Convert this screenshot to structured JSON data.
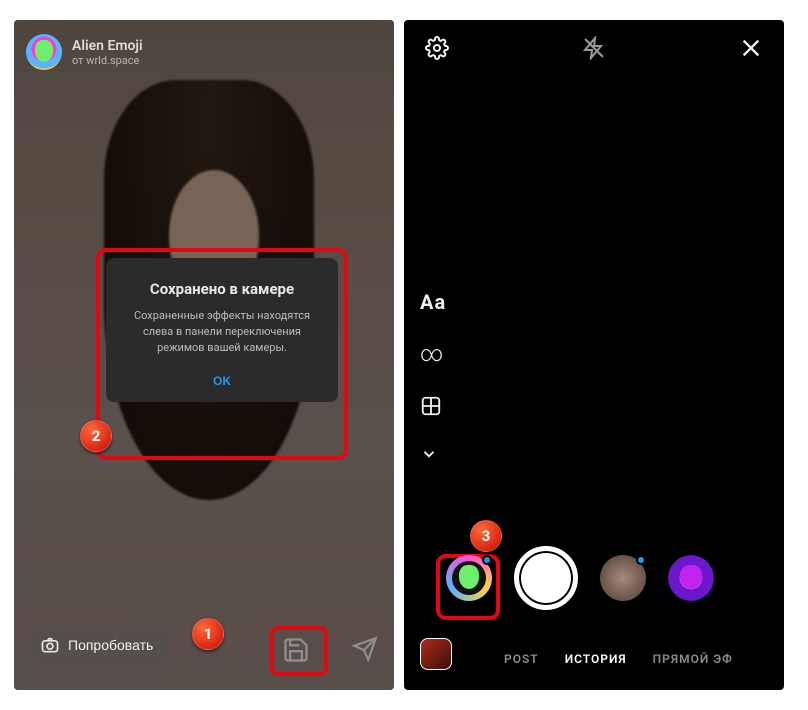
{
  "left": {
    "effect_header": {
      "title": "Alien Emoji",
      "subtitle": "от wrld.space"
    },
    "dialog": {
      "title": "Сохранено в камере",
      "body": "Сохраненные эффекты находятся слева в панели переключения режимов вашей камеры.",
      "ok": "OK"
    },
    "try_label": "Попробовать"
  },
  "right": {
    "sidebar": {
      "text_mode": "Aa",
      "boomerang_symbol": "∞"
    },
    "modes": {
      "post": "POST",
      "story": "ИСТОРИЯ",
      "live": "ПРЯМОЙ ЭФ"
    }
  },
  "annotations": {
    "b1": "1",
    "b2": "2",
    "b3": "3"
  },
  "colors": {
    "highlight": "#e30613",
    "accent": "#1e9bf0"
  }
}
